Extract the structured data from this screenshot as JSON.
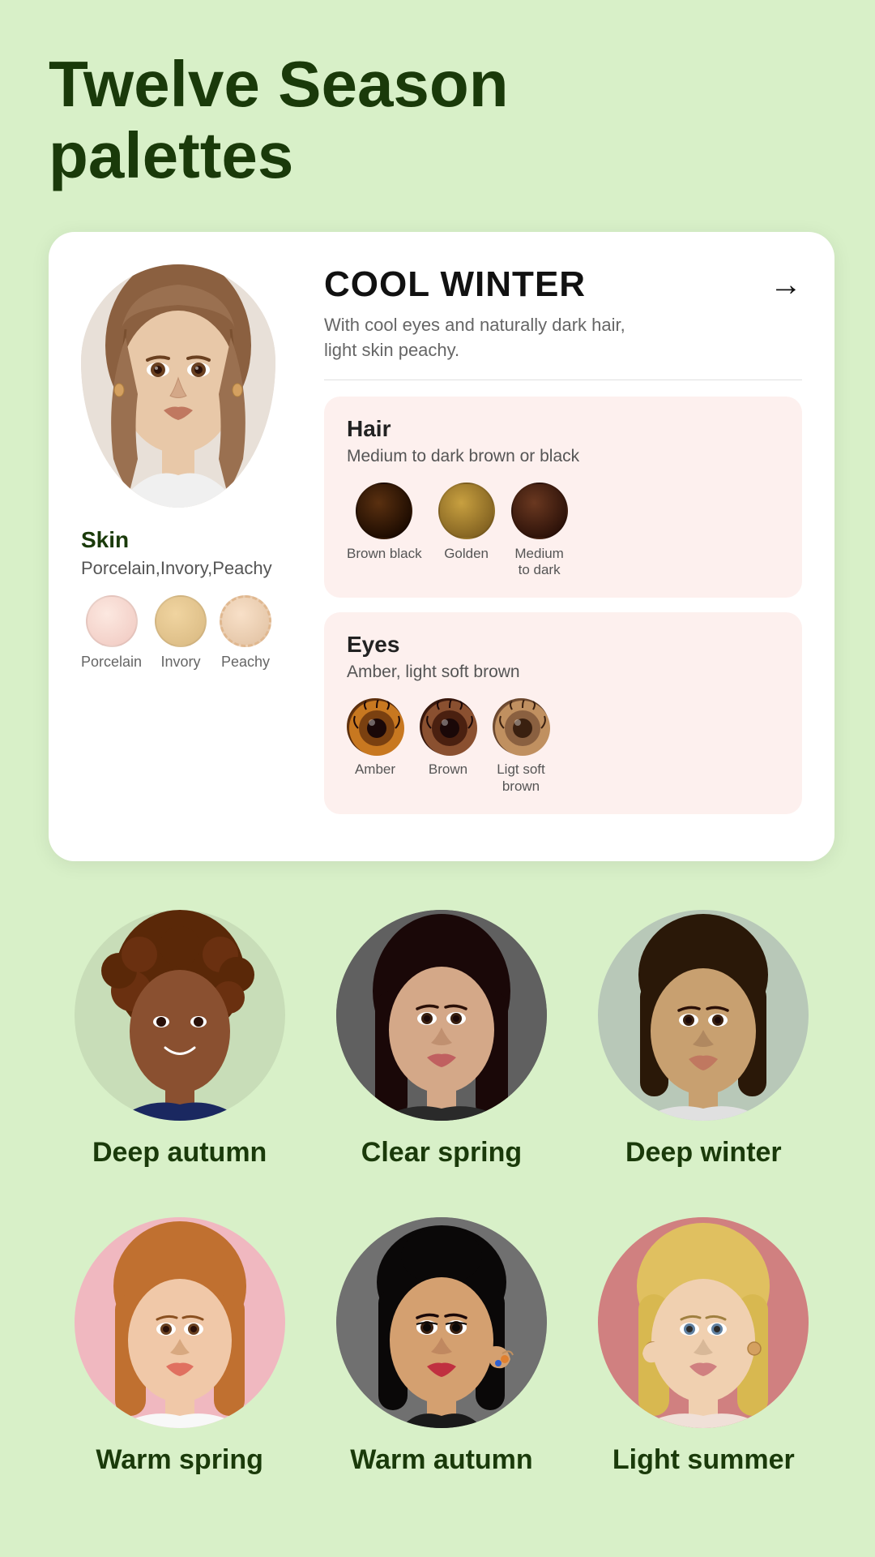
{
  "page": {
    "title_line1": "Twelve Season",
    "title_line2": "palettes",
    "background_color": "#d8f0c8"
  },
  "card": {
    "season_name": "COOL WINTER",
    "season_description": "With cool eyes and naturally dark hair,\nlight skin peachy.",
    "arrow": "→",
    "skin": {
      "label": "Skin",
      "subtitle": "Porcelain,Invory,Peachy",
      "swatches": [
        {
          "label": "Porcelain",
          "color": "#f5d5d0"
        },
        {
          "label": "Invory",
          "color": "#e8c898"
        },
        {
          "label": "Peachy",
          "color": "#f0d8b8"
        }
      ]
    },
    "hair": {
      "label": "Hair",
      "subtitle": "Medium to dark brown or black",
      "items": [
        {
          "label": "Brown black",
          "type": "hair-brown-black"
        },
        {
          "label": "Golden",
          "type": "hair-golden"
        },
        {
          "label": "Medium\nto dark",
          "type": "hair-medium-dark"
        }
      ]
    },
    "eyes": {
      "label": "Eyes",
      "subtitle": "Amber, light soft brown",
      "items": [
        {
          "label": "Amber",
          "type": "eye-amber"
        },
        {
          "label": "Brown",
          "type": "eye-brown"
        },
        {
          "label": "Ligt soft\nbrown",
          "type": "eye-light-soft-brown"
        }
      ]
    }
  },
  "persons_row1": [
    {
      "label": "Deep autumn",
      "bg_class": "bg-green"
    },
    {
      "label": "Clear spring",
      "bg_class": "bg-dark"
    },
    {
      "label": "Deep winter",
      "bg_class": "bg-light"
    }
  ],
  "persons_row2": [
    {
      "label": "Warm spring",
      "bg_class": "bg-pink"
    },
    {
      "label": "Warm autumn",
      "bg_class": "bg-gray"
    },
    {
      "label": "Light summer",
      "bg_class": "bg-rose"
    }
  ]
}
